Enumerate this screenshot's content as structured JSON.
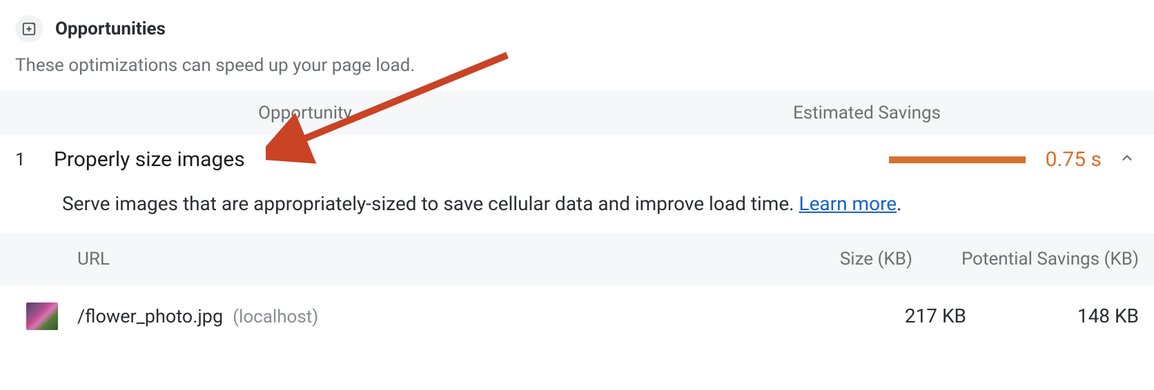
{
  "section": {
    "title": "Opportunities",
    "subtitle": "These optimizations can speed up your page load."
  },
  "columns": {
    "opportunity": "Opportunity",
    "savings": "Estimated Savings",
    "url": "URL",
    "size": "Size (KB)",
    "potential": "Potential Savings (KB)"
  },
  "opportunity": {
    "index": "1",
    "name": "Properly size images",
    "savings_value": "0.75 s",
    "description": "Serve images that are appropriately-sized to save cellular data and improve load time. ",
    "learn_more": "Learn more",
    "period": "."
  },
  "row": {
    "path": "/flower_photo.jpg",
    "host": "(localhost)",
    "size": "217 KB",
    "potential": "148 KB"
  },
  "colors": {
    "accent": "#d6712f",
    "link": "#175fce"
  }
}
